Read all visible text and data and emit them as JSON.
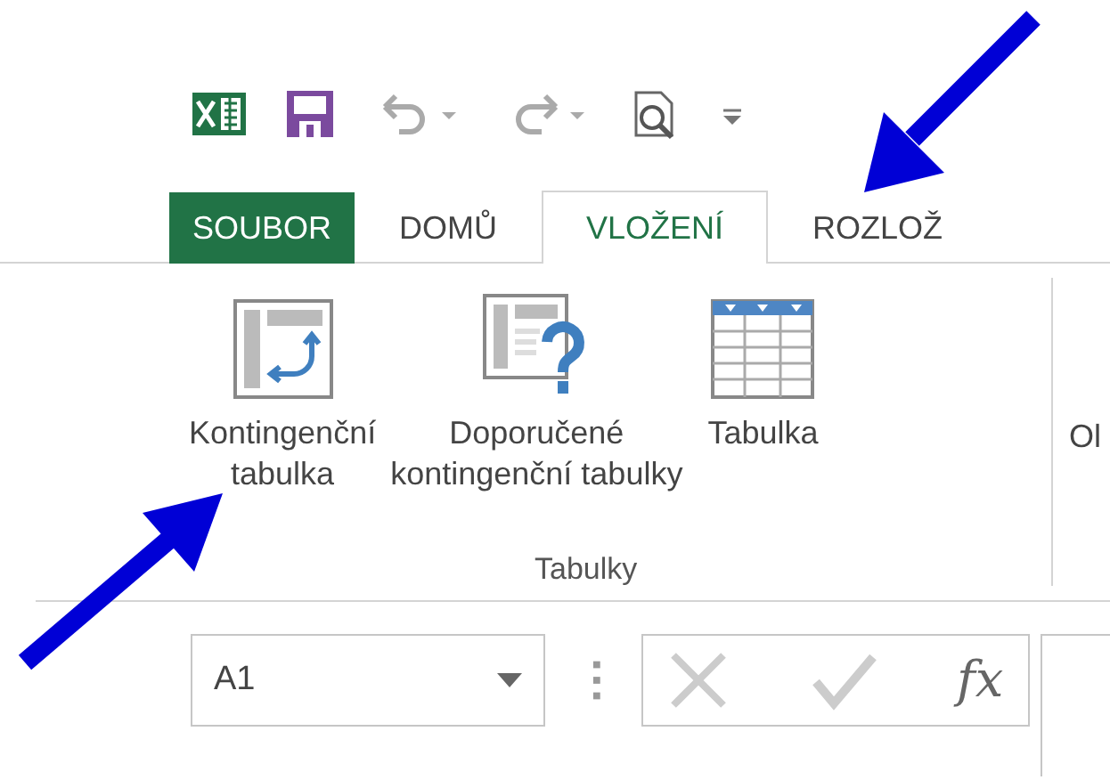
{
  "tabs": [
    {
      "label": "SOUBOR",
      "kind": "file",
      "selected": false
    },
    {
      "label": "DOMŮ",
      "kind": "tab",
      "selected": false
    },
    {
      "label": "VLOŽENÍ",
      "kind": "tab",
      "selected": true
    },
    {
      "label": "ROZLOŽ",
      "kind": "tab",
      "selected": false
    }
  ],
  "ribbon": {
    "buttons": [
      {
        "label": "Kontingenční\ntabulka",
        "kind": "pivot"
      },
      {
        "label": "Doporučené\nkontingenční tabulky",
        "kind": "recommended"
      },
      {
        "label": "Tabulka",
        "kind": "table"
      }
    ],
    "group_label": "Tabulky",
    "next_group_label": "Ol"
  },
  "formula_bar": {
    "name_box": "A1",
    "function_label": "fx"
  }
}
